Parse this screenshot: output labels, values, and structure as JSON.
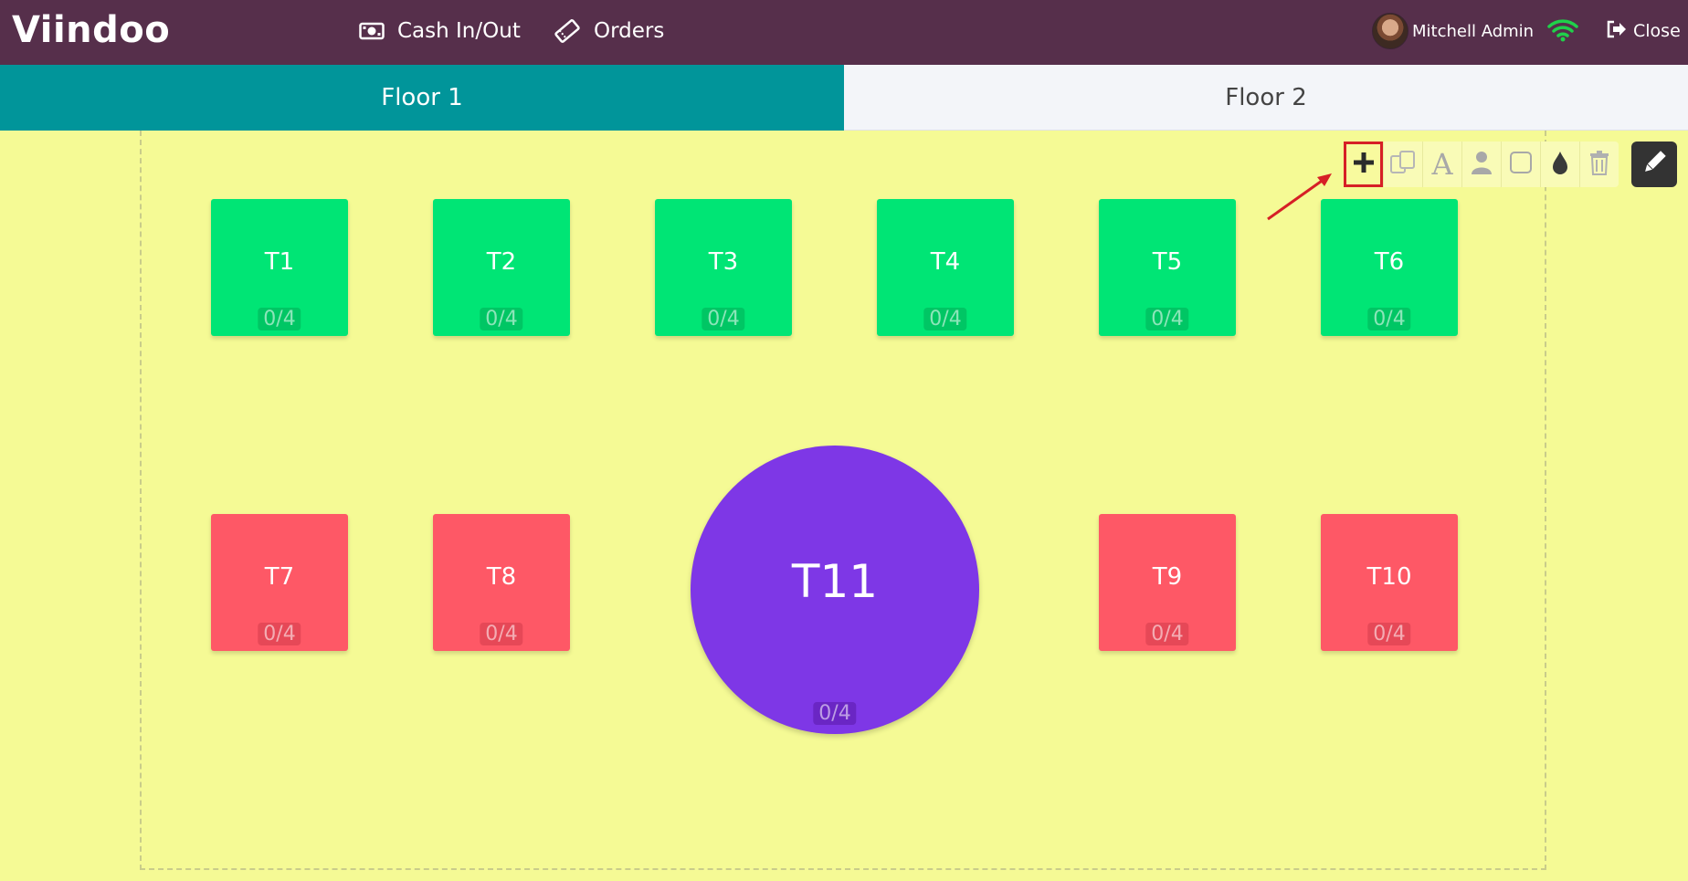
{
  "header": {
    "logo": "Viindoo",
    "cash_label": "Cash In/Out",
    "orders_label": "Orders",
    "user_name": "Mitchell Admin",
    "close_label": "Close"
  },
  "floors": [
    {
      "label": "Floor 1",
      "active": true
    },
    {
      "label": "Floor 2",
      "active": false
    }
  ],
  "toolbar": {
    "tools": [
      "add-table-icon",
      "duplicate-icon",
      "rename-icon",
      "seats-icon",
      "shape-icon",
      "color-icon",
      "trash-icon"
    ],
    "edit_icon": "pencil-icon"
  },
  "tables": [
    {
      "name": "T1",
      "seats": "0/4",
      "color": "#00e575"
    },
    {
      "name": "T2",
      "seats": "0/4",
      "color": "#00e575"
    },
    {
      "name": "T3",
      "seats": "0/4",
      "color": "#00e575"
    },
    {
      "name": "T4",
      "seats": "0/4",
      "color": "#00e575"
    },
    {
      "name": "T5",
      "seats": "0/4",
      "color": "#00e575"
    },
    {
      "name": "T6",
      "seats": "0/4",
      "color": "#00e575"
    },
    {
      "name": "T7",
      "seats": "0/4",
      "color": "#fe5866"
    },
    {
      "name": "T8",
      "seats": "0/4",
      "color": "#fe5866"
    },
    {
      "name": "T11",
      "seats": "0/4",
      "color": "#7e37e6"
    },
    {
      "name": "T9",
      "seats": "0/4",
      "color": "#fe5866"
    },
    {
      "name": "T10",
      "seats": "0/4",
      "color": "#fe5866"
    }
  ],
  "colors": {
    "header_bg": "#562f4b",
    "active_floor_bg": "#01959a",
    "floor_bg": "#f5fa95",
    "highlight": "#d61f26"
  }
}
